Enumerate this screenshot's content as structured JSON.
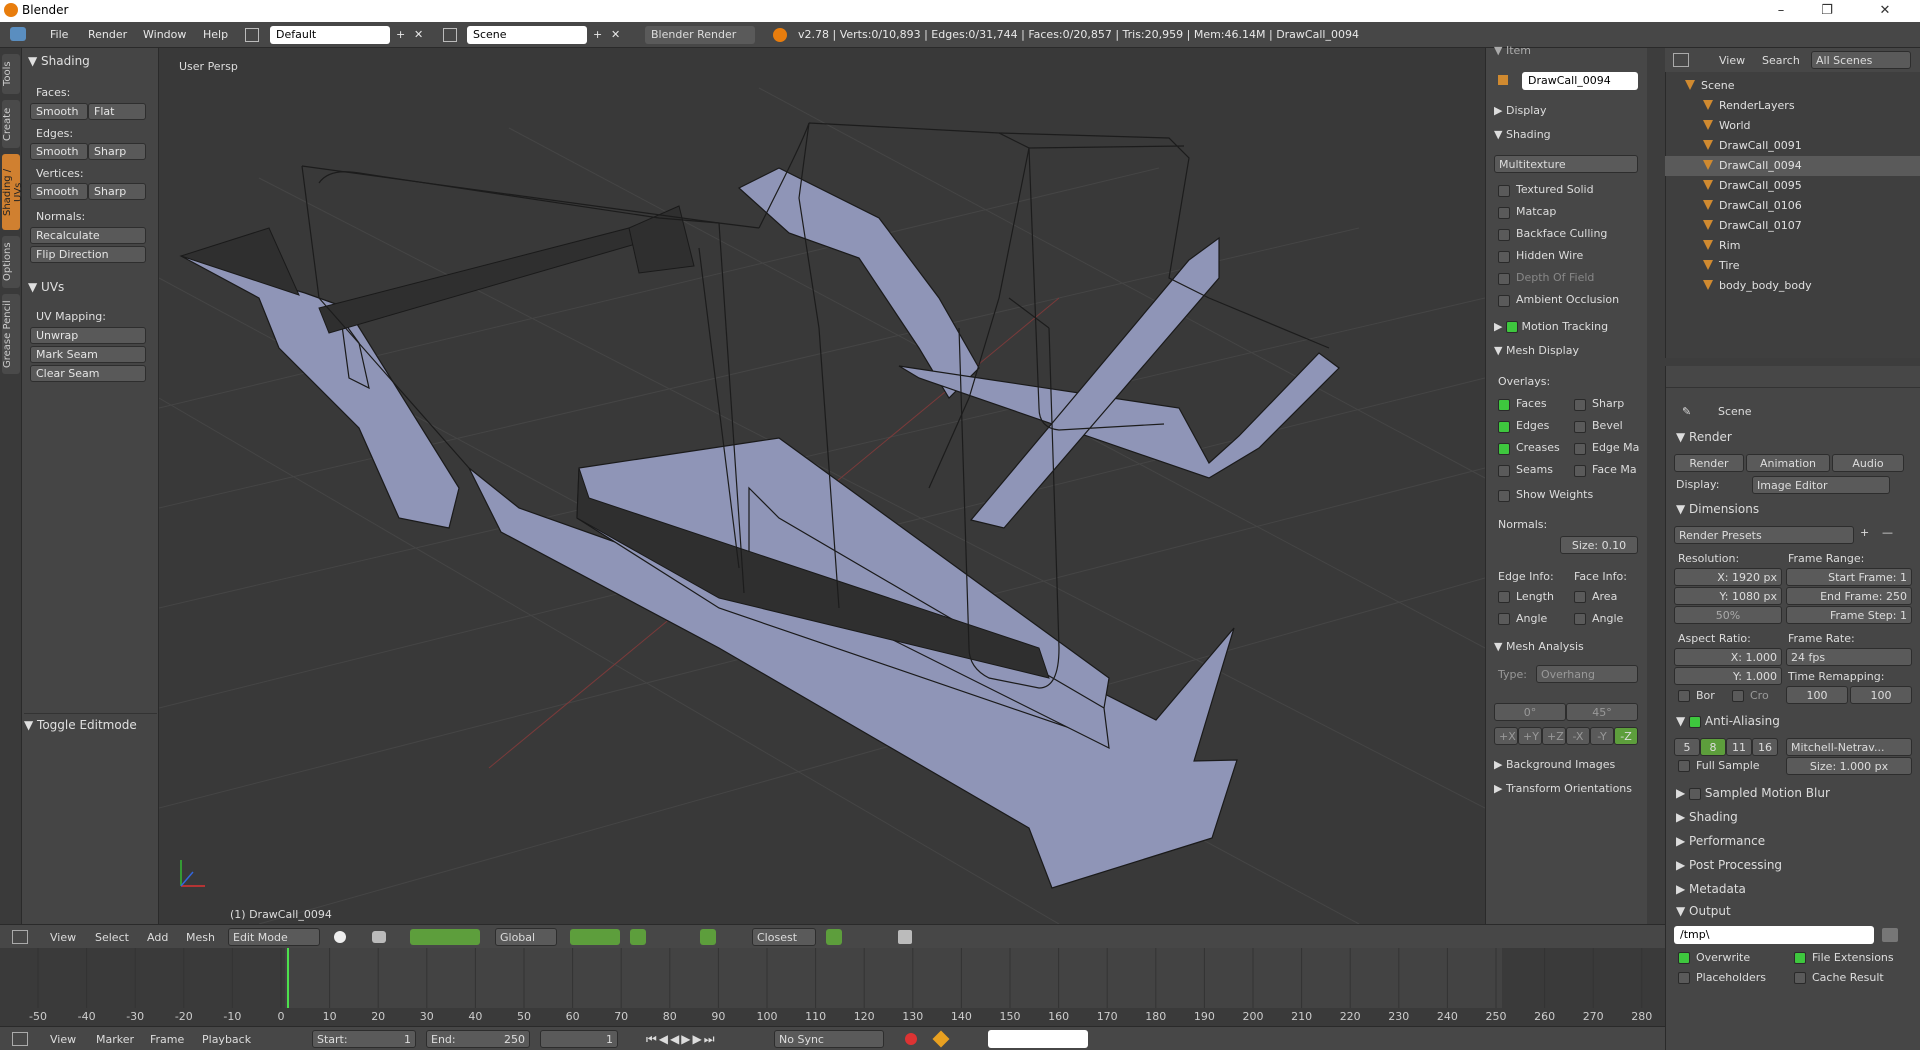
{
  "app": {
    "title": "Blender"
  },
  "window_controls": {
    "minimize": "–",
    "maximize": "❐",
    "close": "✕"
  },
  "menus": [
    "File",
    "Render",
    "Window",
    "Help"
  ],
  "layout": {
    "screen": "Default",
    "scene": "Scene",
    "engine": "Blender Render"
  },
  "stats": "v2.78 | Verts:0/10,893 | Edges:0/31,744 | Faces:0/20,857 | Tris:20,959 | Mem:46.14M | DrawCall_0094",
  "tool_tabs": [
    "Tools",
    "Create",
    "Shading / UVs",
    "Options",
    "Grease Pencil"
  ],
  "toolshelf": {
    "shading_panel": "Shading",
    "faces_label": "Faces:",
    "smooth": "Smooth",
    "flat": "Flat",
    "edges_label": "Edges:",
    "sharp": "Sharp",
    "vertices_label": "Vertices:",
    "normals_label": "Normals:",
    "recalculate": "Recalculate",
    "flip": "Flip Direction",
    "uvs_panel": "UVs",
    "uv_mapping": "UV Mapping:",
    "unwrap": "Unwrap",
    "mark_seam": "Mark Seam",
    "clear_seam": "Clear Seam",
    "toggle_editmode": "Toggle Editmode"
  },
  "viewport": {
    "label": "User Persp",
    "object": "(1) DrawCall_0094"
  },
  "properties": {
    "item": "Item",
    "item_name": "DrawCall_0094",
    "display": "Display",
    "shading": "Shading",
    "multitexture": "Multitexture",
    "shading_opts": [
      "Textured Solid",
      "Matcap",
      "Backface Culling",
      "Hidden Wire",
      "Depth Of Field",
      "Ambient Occlusion"
    ],
    "motion_tracking": "Motion Tracking",
    "mesh_display": "Mesh Display",
    "overlays": "Overlays:",
    "overlay_left": [
      {
        "label": "Faces",
        "on": true
      },
      {
        "label": "Edges",
        "on": true
      },
      {
        "label": "Creases",
        "on": true
      },
      {
        "label": "Seams",
        "on": false
      }
    ],
    "overlay_right": [
      {
        "label": "Sharp",
        "on": false
      },
      {
        "label": "Bevel",
        "on": false
      },
      {
        "label": "Edge Ma",
        "on": false
      },
      {
        "label": "Face Ma",
        "on": false
      }
    ],
    "show_weights": "Show Weights",
    "normals": "Normals:",
    "size": "Size:",
    "size_val": "0.10",
    "edge_info": "Edge Info:",
    "face_info": "Face Info:",
    "length": "Length",
    "area": "Area",
    "angle": "Angle",
    "mesh_analysis": "Mesh Analysis",
    "type": "Type:",
    "overhang": "Overhang",
    "range_min": "0°",
    "range_max": "45°",
    "axes": [
      "+X",
      "+Y",
      "+Z",
      "-X",
      "-Y",
      "-Z"
    ],
    "background_images": "Background Images",
    "transform_orient": "Transform Orientations"
  },
  "outliner": {
    "view": "View",
    "search": "Search",
    "all_scenes": "All Scenes",
    "items": [
      {
        "name": "Scene",
        "indent": 0,
        "selected": false
      },
      {
        "name": "RenderLayers",
        "indent": 1,
        "selected": false
      },
      {
        "name": "World",
        "indent": 1,
        "selected": false
      },
      {
        "name": "DrawCall_0091",
        "indent": 1,
        "selected": false
      },
      {
        "name": "DrawCall_0094",
        "indent": 1,
        "selected": true
      },
      {
        "name": "DrawCall_0095",
        "indent": 1,
        "selected": false
      },
      {
        "name": "DrawCall_0106",
        "indent": 1,
        "selected": false
      },
      {
        "name": "DrawCall_0107",
        "indent": 1,
        "selected": false
      },
      {
        "name": "Rim",
        "indent": 1,
        "selected": false
      },
      {
        "name": "Tire",
        "indent": 1,
        "selected": false
      },
      {
        "name": "body_body_body",
        "indent": 1,
        "selected": false
      }
    ]
  },
  "render": {
    "scene": "Scene",
    "render": "Render",
    "render_btn": "Render",
    "animation": "Animation",
    "audio": "Audio",
    "display": "Display:",
    "display_val": "Image Editor",
    "dimensions": "Dimensions",
    "presets": "Render Presets",
    "resolution": "Resolution:",
    "res_x": "X:",
    "res_x_val": "1920 px",
    "res_y": "Y:",
    "res_y_val": "1080 px",
    "percent": "50%",
    "frame_range": "Frame Range:",
    "start_frame": "Start Frame:",
    "start_val": "1",
    "end_frame": "End Frame:",
    "end_val": "250",
    "frame_step": "Frame Step:",
    "step_val": "1",
    "aspect": "Aspect Ratio:",
    "asp_x": "1.000",
    "asp_y": "1.000",
    "frame_rate": "Frame Rate:",
    "fps": "24 fps",
    "time_remap": "Time Remapping:",
    "remap_a": "100",
    "remap_b": "100",
    "bor": "Bor",
    "cro": "Cro",
    "anti_aliasing": "Anti-Aliasing",
    "aa_samples": [
      "5",
      "8",
      "11",
      "16"
    ],
    "filter": "Mitchell-Netrav...",
    "full_sample": "Full Sample",
    "filter_size": "Size: 1.000 px",
    "sampled_motion_blur": "Sampled Motion Blur",
    "sections": [
      "Shading",
      "Performance",
      "Post Processing",
      "Metadata"
    ],
    "output": "Output",
    "output_path": "/tmp\\",
    "overwrite": "Overwrite",
    "file_ext": "File Extensions",
    "placeholders": "Placeholders",
    "cache": "Cache Result"
  },
  "viewport_header": {
    "view": "View",
    "select": "Select",
    "add": "Add",
    "mesh": "Mesh",
    "mode": "Edit Mode",
    "orientation": "Global",
    "snap": "Closest"
  },
  "timeline": {
    "ticks": [
      "-50",
      "-40",
      "-30",
      "-20",
      "-10",
      "0",
      "10",
      "20",
      "30",
      "40",
      "50",
      "60",
      "70",
      "80",
      "90",
      "100",
      "110",
      "120",
      "130",
      "140",
      "150",
      "160",
      "170",
      "180",
      "190",
      "200",
      "210",
      "220",
      "230",
      "240",
      "250",
      "260",
      "270",
      "280"
    ],
    "view": "View",
    "marker": "Marker",
    "frame": "Frame",
    "playback": "Playback",
    "start_label": "Start:",
    "start": "1",
    "end_label": "End:",
    "end": "250",
    "current": "1",
    "sync": "No Sync"
  }
}
